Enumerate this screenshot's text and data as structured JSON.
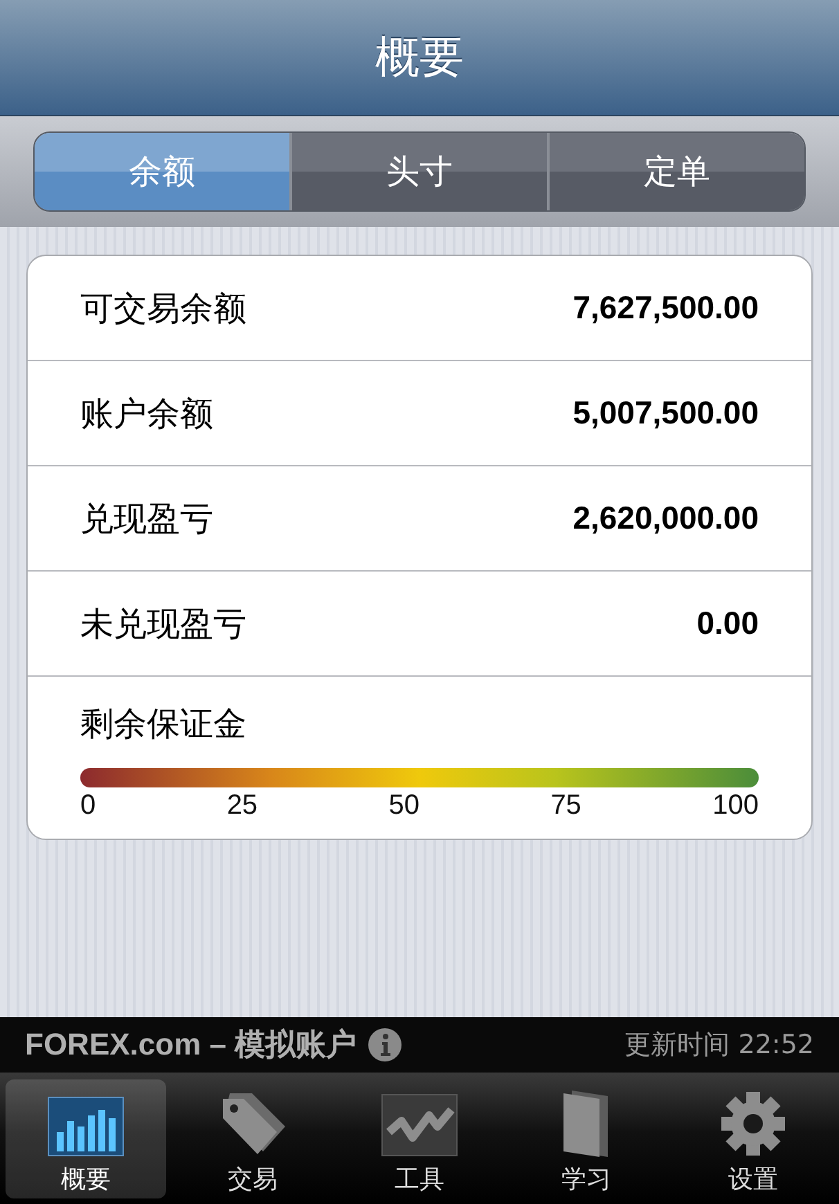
{
  "title": "概要",
  "segments": [
    {
      "label": "余额",
      "selected": true
    },
    {
      "label": "头寸",
      "selected": false
    },
    {
      "label": "定单",
      "selected": false
    }
  ],
  "rows": [
    {
      "label": "可交易余额",
      "value": "7,627,500.00"
    },
    {
      "label": "账户余额",
      "value": "5,007,500.00"
    },
    {
      "label": "兑现盈亏",
      "value": "2,620,000.00"
    },
    {
      "label": "未兑现盈亏",
      "value": "0.00"
    }
  ],
  "margin": {
    "label": "剩余保证金",
    "ticks": [
      "0",
      "25",
      "50",
      "75",
      "100"
    ]
  },
  "status_bar": {
    "account": "FOREX.com – 模拟账户",
    "updated": "更新时间 22:52"
  },
  "tab_bar": [
    {
      "label": "概要",
      "kind": "chart",
      "selected": true
    },
    {
      "label": "交易",
      "kind": "tag",
      "selected": false
    },
    {
      "label": "工具",
      "kind": "trend",
      "selected": false
    },
    {
      "label": "学习",
      "kind": "book",
      "selected": false
    },
    {
      "label": "设置",
      "kind": "gear",
      "selected": false
    }
  ]
}
